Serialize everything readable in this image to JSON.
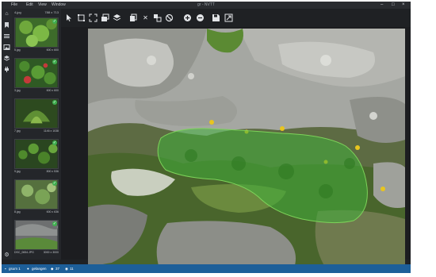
{
  "menubar": {
    "items": [
      "File",
      "Edit",
      "View",
      "Window"
    ],
    "title": "gr - NVTT"
  },
  "thumbnails": {
    "header_label": "4.jpg",
    "header_size": "788 x 713",
    "items": [
      {
        "name": "5.jpg",
        "size": "600 x 600"
      },
      {
        "name": "3.jpg",
        "size": "600 x 600"
      },
      {
        "name": "7.jpg",
        "size": "1146 x 1038"
      },
      {
        "name": "9.jpg",
        "size": "800 x 536"
      },
      {
        "name": "8.jpg",
        "size": "600 x 636"
      },
      {
        "name": "DSC_0654.JPG",
        "size": "3000 x 3000"
      }
    ]
  },
  "statusbar": {
    "project": "gsum 1",
    "user": "gelangen",
    "count_a": "37",
    "count_b": "11"
  },
  "colors": {
    "accent": "#1d5f99",
    "mask": "#3fae3a",
    "check": "#3fae4f"
  },
  "icons": {
    "toolbar": [
      "pointer-icon",
      "rect-select-icon",
      "fit-icon",
      "layers-icon",
      "stack-icon",
      "copy-icon",
      "delete-icon",
      "duplicate-icon",
      "ban-icon",
      "add-icon",
      "remove-icon",
      "save-icon",
      "export-icon"
    ],
    "sidebar": [
      "home-icon",
      "bookmark-icon",
      "list-icon",
      "image-icon",
      "layers-icon",
      "plugin-icon",
      "settings-icon"
    ]
  }
}
